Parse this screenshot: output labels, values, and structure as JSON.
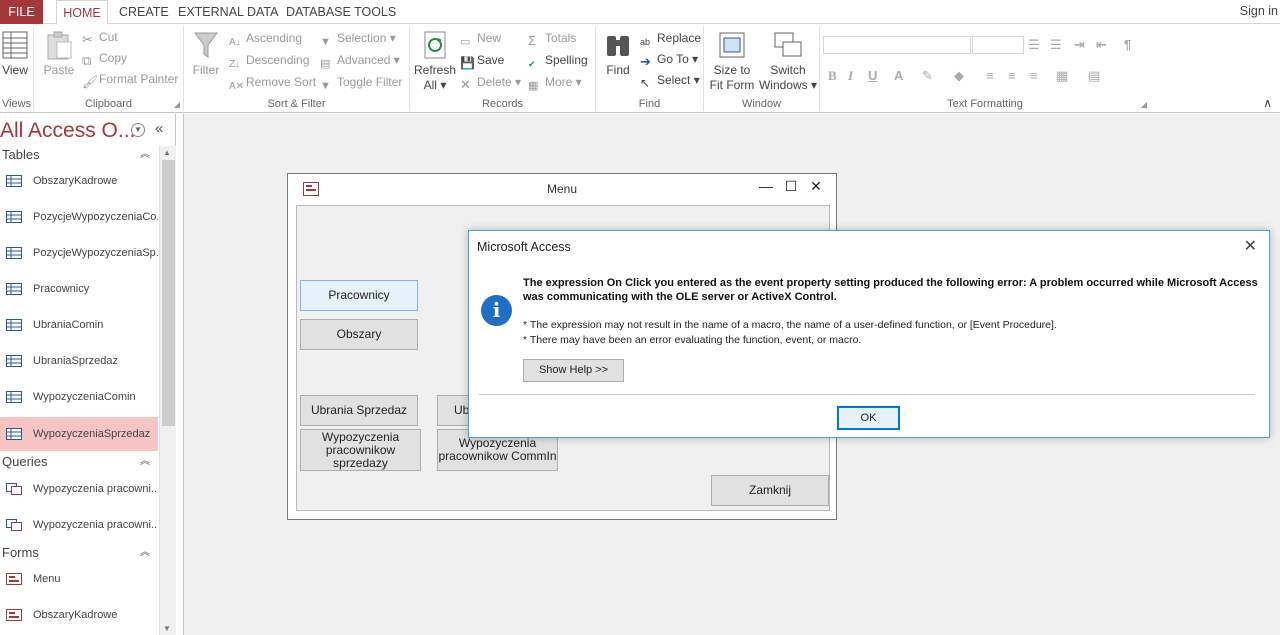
{
  "tabs": {
    "file": "FILE",
    "home": "HOME",
    "create": "CREATE",
    "external": "EXTERNAL DATA",
    "dbtools": "DATABASE TOOLS",
    "signin": "Sign in"
  },
  "ribbon": {
    "views": {
      "label": "Views",
      "view": "View"
    },
    "clipboard": {
      "label": "Clipboard",
      "paste": "Paste",
      "cut": "Cut",
      "copy": "Copy",
      "format_painter": "Format Painter"
    },
    "sort_filter": {
      "label": "Sort & Filter",
      "filter": "Filter",
      "ascending": "Ascending",
      "descending": "Descending",
      "remove_sort": "Remove Sort",
      "selection": "Selection",
      "advanced": "Advanced",
      "toggle_filter": "Toggle Filter"
    },
    "records": {
      "label": "Records",
      "refresh": "Refresh",
      "refresh2": "All",
      "new": "New",
      "save": "Save",
      "delete": "Delete",
      "totals": "Totals",
      "spelling": "Spelling",
      "more": "More"
    },
    "find": {
      "label": "Find",
      "find": "Find",
      "replace": "Replace",
      "goto": "Go To",
      "select": "Select"
    },
    "window": {
      "label": "Window",
      "size_to_fit1": "Size to",
      "size_to_fit2": "Fit Form",
      "switch1": "Switch",
      "switch2": "Windows"
    },
    "text_formatting": {
      "label": "Text Formatting"
    }
  },
  "nav": {
    "title": "All Access O...",
    "sections": [
      {
        "label": "Tables",
        "items": [
          "ObszaryKadrowe",
          "PozycjeWypozyczeniaCo...",
          "PozycjeWypozyczeniaSp...",
          "Pracownicy",
          "UbraniaComin",
          "UbraniaSprzedaz",
          "WypozyczeniaComin",
          "WypozyczeniaSprzedaz"
        ]
      },
      {
        "label": "Queries",
        "items": [
          "Wypozyczenia pracowni...",
          "Wypozyczenia pracowni..."
        ]
      },
      {
        "label": "Forms",
        "items": [
          "Menu",
          "ObszaryKadrowe"
        ]
      }
    ],
    "selected": "WypozyczeniaSprzedaz"
  },
  "form": {
    "title": "Menu",
    "buttons": {
      "pracownicy": "Pracownicy",
      "obszary": "Obszary",
      "ubrania_sprzedaz": "Ubrania Sprzedaz",
      "ubrania_comin": "Ubr",
      "wyp_sprzedazy_1": "Wypozyczenia",
      "wyp_sprzedazy_2": "pracownikow sprzedazy",
      "wyp_commin_1": "Wypozyczenia",
      "wyp_commin_2": "pracownikow CommIn",
      "zamknij": "Zamknij"
    }
  },
  "dialog": {
    "title": "Microsoft Access",
    "heading": "The expression On Click you entered as the event property setting produced the following error: A problem occurred while Microsoft Access was communicating with the OLE server or ActiveX Control.",
    "line1": "* The expression may not result in the name of a macro, the name of a user-defined function, or [Event Procedure].",
    "line2": "* There may have been an error evaluating the function, event, or macro.",
    "show_help": "Show Help >>",
    "ok": "OK"
  }
}
